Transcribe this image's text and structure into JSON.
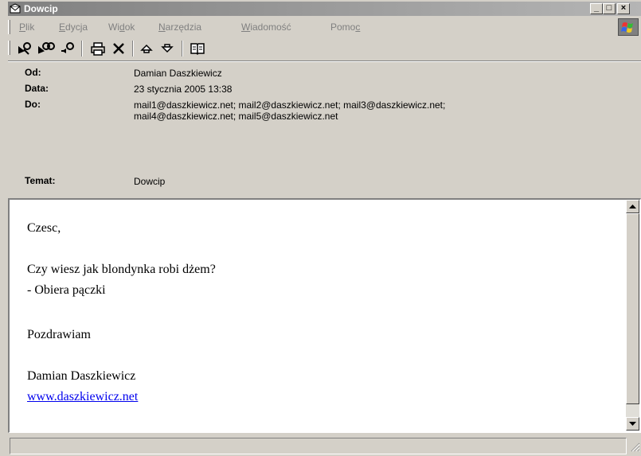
{
  "window": {
    "title": "Dowcip",
    "controls": {
      "minimize": "_",
      "maximize": "□",
      "close": "×"
    }
  },
  "menu": {
    "items": [
      {
        "underline": "P",
        "rest": "lik"
      },
      {
        "underline": "E",
        "rest": "dycja"
      },
      {
        "pre": "Wi",
        "underline": "d",
        "rest": "ok"
      },
      {
        "underline": "N",
        "rest": "arzędzia"
      },
      {
        "underline": "W",
        "rest": "iadomość"
      },
      {
        "pre": "Pomo",
        "underline": "c",
        "rest": ""
      }
    ]
  },
  "toolbar": {
    "icons": [
      "reply-icon",
      "reply-all-icon",
      "forward-icon",
      "print-icon",
      "delete-icon",
      "previous-icon",
      "next-icon",
      "address-book-icon"
    ]
  },
  "header": {
    "from_label": "Od:",
    "from_value": "Damian Daszkiewicz",
    "date_label": "Data:",
    "date_value": "23 stycznia 2005 13:38",
    "to_label": "Do:",
    "to_value_line1": "mail1@daszkiewicz.net; mail2@daszkiewicz.net; mail3@daszkiewicz.net;",
    "to_value_line2": "mail4@daszkiewicz.net; mail5@daszkiewicz.net",
    "subject_label": "Temat:",
    "subject_value": "Dowcip"
  },
  "message": {
    "greeting": "Czesc,",
    "line1": "Czy wiesz jak blondynka robi dżem?",
    "line2": "- Obiera pączki",
    "closing": "Pozdrawiam",
    "signature": "Damian Daszkiewicz",
    "link": "www.daszkiewicz.net"
  },
  "colors": {
    "chrome": "#d4d0c8",
    "titlebar_inactive": "#808080",
    "link": "#0000ee",
    "disabled_text": "#808080"
  }
}
